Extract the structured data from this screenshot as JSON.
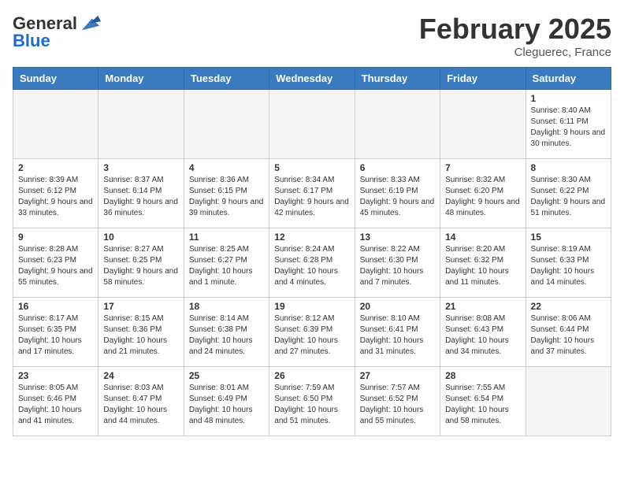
{
  "header": {
    "logo_line1": "General",
    "logo_line2": "Blue",
    "month_title": "February 2025",
    "location": "Cleguerec, France"
  },
  "weekdays": [
    "Sunday",
    "Monday",
    "Tuesday",
    "Wednesday",
    "Thursday",
    "Friday",
    "Saturday"
  ],
  "weeks": [
    [
      {
        "day": "",
        "info": ""
      },
      {
        "day": "",
        "info": ""
      },
      {
        "day": "",
        "info": ""
      },
      {
        "day": "",
        "info": ""
      },
      {
        "day": "",
        "info": ""
      },
      {
        "day": "",
        "info": ""
      },
      {
        "day": "1",
        "info": "Sunrise: 8:40 AM\nSunset: 6:11 PM\nDaylight: 9 hours and 30 minutes."
      }
    ],
    [
      {
        "day": "2",
        "info": "Sunrise: 8:39 AM\nSunset: 6:12 PM\nDaylight: 9 hours and 33 minutes."
      },
      {
        "day": "3",
        "info": "Sunrise: 8:37 AM\nSunset: 6:14 PM\nDaylight: 9 hours and 36 minutes."
      },
      {
        "day": "4",
        "info": "Sunrise: 8:36 AM\nSunset: 6:15 PM\nDaylight: 9 hours and 39 minutes."
      },
      {
        "day": "5",
        "info": "Sunrise: 8:34 AM\nSunset: 6:17 PM\nDaylight: 9 hours and 42 minutes."
      },
      {
        "day": "6",
        "info": "Sunrise: 8:33 AM\nSunset: 6:19 PM\nDaylight: 9 hours and 45 minutes."
      },
      {
        "day": "7",
        "info": "Sunrise: 8:32 AM\nSunset: 6:20 PM\nDaylight: 9 hours and 48 minutes."
      },
      {
        "day": "8",
        "info": "Sunrise: 8:30 AM\nSunset: 6:22 PM\nDaylight: 9 hours and 51 minutes."
      }
    ],
    [
      {
        "day": "9",
        "info": "Sunrise: 8:28 AM\nSunset: 6:23 PM\nDaylight: 9 hours and 55 minutes."
      },
      {
        "day": "10",
        "info": "Sunrise: 8:27 AM\nSunset: 6:25 PM\nDaylight: 9 hours and 58 minutes."
      },
      {
        "day": "11",
        "info": "Sunrise: 8:25 AM\nSunset: 6:27 PM\nDaylight: 10 hours and 1 minute."
      },
      {
        "day": "12",
        "info": "Sunrise: 8:24 AM\nSunset: 6:28 PM\nDaylight: 10 hours and 4 minutes."
      },
      {
        "day": "13",
        "info": "Sunrise: 8:22 AM\nSunset: 6:30 PM\nDaylight: 10 hours and 7 minutes."
      },
      {
        "day": "14",
        "info": "Sunrise: 8:20 AM\nSunset: 6:32 PM\nDaylight: 10 hours and 11 minutes."
      },
      {
        "day": "15",
        "info": "Sunrise: 8:19 AM\nSunset: 6:33 PM\nDaylight: 10 hours and 14 minutes."
      }
    ],
    [
      {
        "day": "16",
        "info": "Sunrise: 8:17 AM\nSunset: 6:35 PM\nDaylight: 10 hours and 17 minutes."
      },
      {
        "day": "17",
        "info": "Sunrise: 8:15 AM\nSunset: 6:36 PM\nDaylight: 10 hours and 21 minutes."
      },
      {
        "day": "18",
        "info": "Sunrise: 8:14 AM\nSunset: 6:38 PM\nDaylight: 10 hours and 24 minutes."
      },
      {
        "day": "19",
        "info": "Sunrise: 8:12 AM\nSunset: 6:39 PM\nDaylight: 10 hours and 27 minutes."
      },
      {
        "day": "20",
        "info": "Sunrise: 8:10 AM\nSunset: 6:41 PM\nDaylight: 10 hours and 31 minutes."
      },
      {
        "day": "21",
        "info": "Sunrise: 8:08 AM\nSunset: 6:43 PM\nDaylight: 10 hours and 34 minutes."
      },
      {
        "day": "22",
        "info": "Sunrise: 8:06 AM\nSunset: 6:44 PM\nDaylight: 10 hours and 37 minutes."
      }
    ],
    [
      {
        "day": "23",
        "info": "Sunrise: 8:05 AM\nSunset: 6:46 PM\nDaylight: 10 hours and 41 minutes."
      },
      {
        "day": "24",
        "info": "Sunrise: 8:03 AM\nSunset: 6:47 PM\nDaylight: 10 hours and 44 minutes."
      },
      {
        "day": "25",
        "info": "Sunrise: 8:01 AM\nSunset: 6:49 PM\nDaylight: 10 hours and 48 minutes."
      },
      {
        "day": "26",
        "info": "Sunrise: 7:59 AM\nSunset: 6:50 PM\nDaylight: 10 hours and 51 minutes."
      },
      {
        "day": "27",
        "info": "Sunrise: 7:57 AM\nSunset: 6:52 PM\nDaylight: 10 hours and 55 minutes."
      },
      {
        "day": "28",
        "info": "Sunrise: 7:55 AM\nSunset: 6:54 PM\nDaylight: 10 hours and 58 minutes."
      },
      {
        "day": "",
        "info": ""
      }
    ]
  ]
}
